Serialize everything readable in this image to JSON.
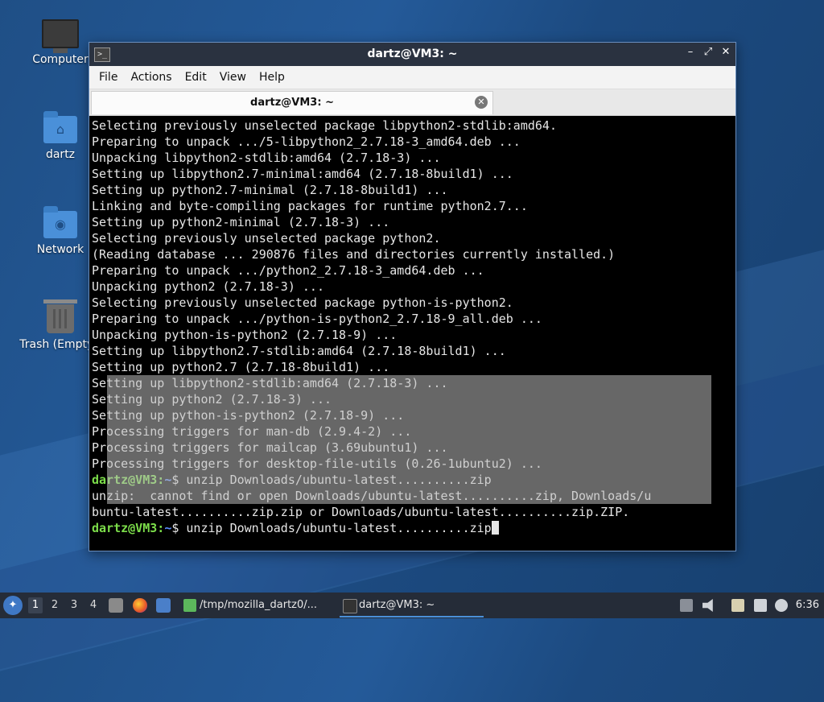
{
  "desktop": {
    "icons": [
      {
        "label": "Computer",
        "icon": "computer-icon"
      },
      {
        "label": "dartz",
        "icon": "home-folder-icon"
      },
      {
        "label": "Network",
        "icon": "network-folder-icon"
      },
      {
        "label": "Trash (Empty)",
        "icon": "trash-icon"
      }
    ]
  },
  "window": {
    "title": "dartz@VM3: ~",
    "app_icon_glyph": ">_",
    "controls": {
      "minimize": "–",
      "maximize": "⤢",
      "close": "✕"
    },
    "menu": [
      "File",
      "Actions",
      "Edit",
      "View",
      "Help"
    ],
    "tab": {
      "label": "dartz@VM3: ~",
      "close_glyph": "✕"
    }
  },
  "terminal": {
    "colors": {
      "text": "#e6e6e6",
      "prompt_user": "#7cdd4a",
      "prompt_path": "#5a8cff",
      "selection": "#bcbcbc"
    },
    "lines": [
      "Selecting previously unselected package libpython2-stdlib:amd64.",
      "Preparing to unpack .../5-libpython2_2.7.18-3_amd64.deb ...",
      "Unpacking libpython2-stdlib:amd64 (2.7.18-3) ...",
      "Setting up libpython2.7-minimal:amd64 (2.7.18-8build1) ...",
      "Setting up python2.7-minimal (2.7.18-8build1) ...",
      "Linking and byte-compiling packages for runtime python2.7...",
      "Setting up python2-minimal (2.7.18-3) ...",
      "Selecting previously unselected package python2.",
      "(Reading database ... 290876 files and directories currently installed.)",
      "Preparing to unpack .../python2_2.7.18-3_amd64.deb ...",
      "Unpacking python2 (2.7.18-3) ...",
      "Selecting previously unselected package python-is-python2.",
      "Preparing to unpack .../python-is-python2_2.7.18-9_all.deb ...",
      "Unpacking python-is-python2 (2.7.18-9) ...",
      "Setting up libpython2.7-stdlib:amd64 (2.7.18-8build1) ...",
      "Setting up python2.7 (2.7.18-8build1) ...",
      "Setting up libpython2-stdlib:amd64 (2.7.18-3) ...",
      "Setting up python2 (2.7.18-3) ...",
      "Setting up python-is-python2 (2.7.18-9) ...",
      "Processing triggers for man-db (2.9.4-2) ...",
      "Processing triggers for mailcap (3.69ubuntu1) ...",
      "Processing triggers for desktop-file-utils (0.26-1ubuntu2) ..."
    ],
    "prompt_user": "dartz@VM3",
    "prompt_sep": ":",
    "prompt_path": "~",
    "prompt_dollar": "$ ",
    "cmd1": "unzip Downloads/ubuntu-latest..........zip",
    "error1": "unzip:  cannot find or open Downloads/ubuntu-latest..........zip, Downloads/u",
    "error2": "buntu-latest..........zip.zip or Downloads/ubuntu-latest..........zip.ZIP.",
    "cmd2": "unzip Downloads/ubuntu-latest..........zip"
  },
  "taskbar": {
    "workspaces": [
      "1",
      "2",
      "3",
      "4"
    ],
    "active_workspace": "1",
    "tasks": [
      {
        "label": "/tmp/mozilla_dartz0/...",
        "icon": "archive-icon"
      },
      {
        "label": "dartz@VM3: ~",
        "icon": "terminal-icon"
      }
    ],
    "clock": "6:36"
  }
}
